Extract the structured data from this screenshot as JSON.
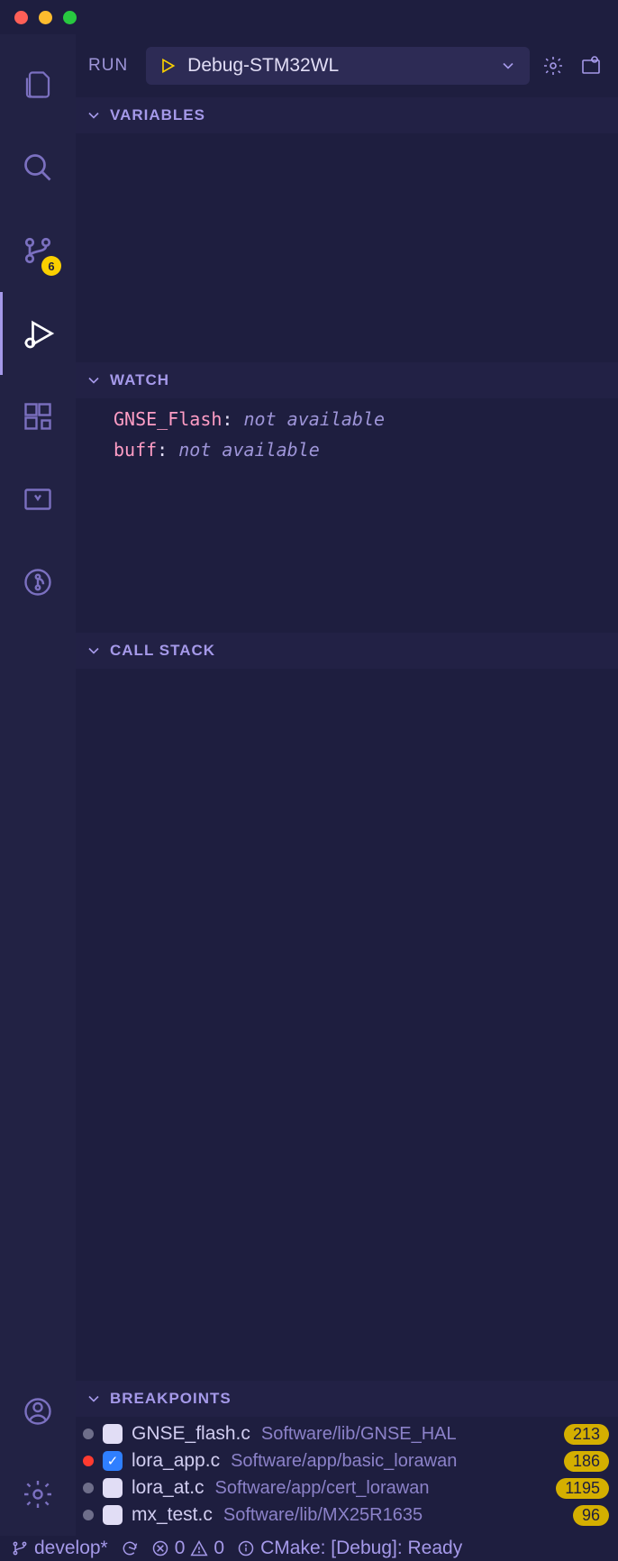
{
  "header": {
    "title_label": "RUN",
    "config_name": "Debug-STM32WL"
  },
  "activity": {
    "scm_badge": "6"
  },
  "sections": {
    "variables_title": "VARIABLES",
    "watch_title": "WATCH",
    "callstack_title": "CALL STACK",
    "breakpoints_title": "BREAKPOINTS"
  },
  "watch": [
    {
      "name": "GNSE_Flash",
      "value": "not available"
    },
    {
      "name": "buff",
      "value": "not available"
    }
  ],
  "breakpoints": [
    {
      "active": false,
      "checked": false,
      "file": "GNSE_flash.c",
      "path": "Software/lib/GNSE_HAL",
      "line": "213"
    },
    {
      "active": true,
      "checked": true,
      "file": "lora_app.c",
      "path": "Software/app/basic_lorawan",
      "line": "186"
    },
    {
      "active": false,
      "checked": false,
      "file": "lora_at.c",
      "path": "Software/app/cert_lorawan",
      "line": "1195"
    },
    {
      "active": false,
      "checked": false,
      "file": "mx_test.c",
      "path": "Software/lib/MX25R1635",
      "line": "96"
    }
  ],
  "statusbar": {
    "branch": "develop*",
    "errors": "0",
    "warnings": "0",
    "cmake": "CMake: [Debug]: Ready"
  }
}
